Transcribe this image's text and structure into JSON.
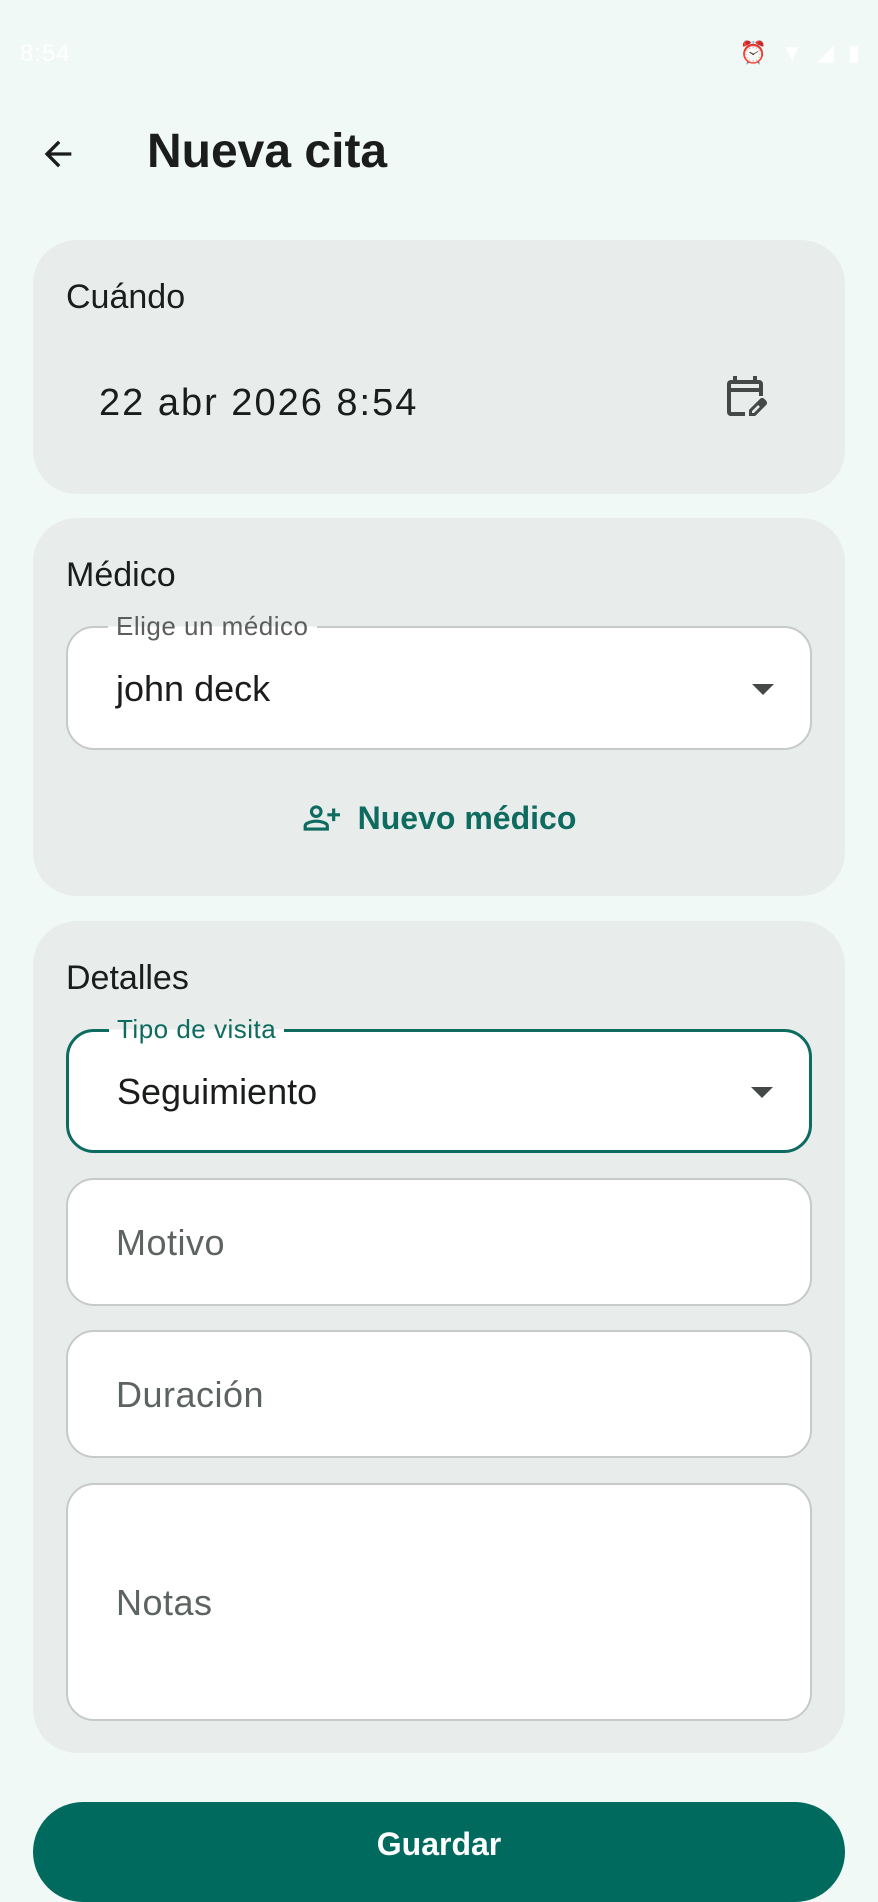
{
  "status_bar": {
    "time": "8:54"
  },
  "app_bar": {
    "title": "Nueva cita",
    "back_icon": "arrow-left-icon"
  },
  "when_card": {
    "title": "Cuándo",
    "date_value": "22 abr 2026 8:54",
    "calendar_icon": "calendar-edit-icon"
  },
  "doctor_card": {
    "title": "Médico",
    "doctor_field": {
      "label": "Elige un médico",
      "value": "john deck"
    },
    "new_doctor_button": {
      "label": "Nuevo médico",
      "icon": "person-add-icon"
    }
  },
  "details_card": {
    "title": "Detalles",
    "visit_type_field": {
      "label": "Tipo de visita",
      "value": "Seguimiento"
    },
    "reason_field": {
      "placeholder": "Motivo"
    },
    "duration_field": {
      "placeholder": "Duración"
    },
    "notes_field": {
      "placeholder": "Notas"
    }
  },
  "save_button": {
    "label": "Guardar"
  },
  "colors": {
    "background": "#f1f9f6",
    "card": "#e8ecea",
    "accent": "#0d6b60",
    "primary_button": "#006a5e"
  }
}
